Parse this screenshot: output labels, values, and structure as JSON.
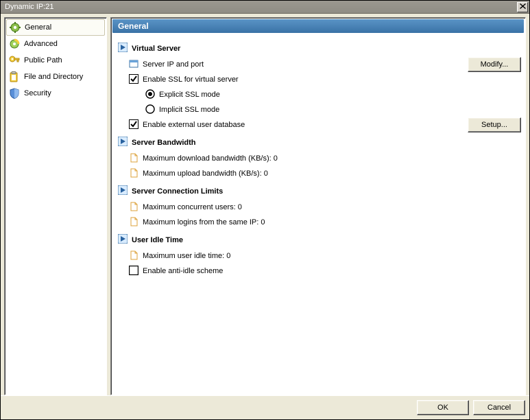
{
  "window": {
    "title": "Dynamic IP:21"
  },
  "sidebar": {
    "items": [
      {
        "label": "General"
      },
      {
        "label": "Advanced"
      },
      {
        "label": "Public Path"
      },
      {
        "label": "File and Directory"
      },
      {
        "label": "Security"
      }
    ]
  },
  "panel": {
    "title": "General"
  },
  "sections": {
    "virtual_server": {
      "title": "Virtual Server",
      "server_ip_port": "Server IP and port",
      "enable_ssl": {
        "label": "Enable SSL for virtual server",
        "checked": true
      },
      "explicit_ssl": {
        "label": "Explicit SSL mode",
        "selected": true
      },
      "implicit_ssl": {
        "label": "Implicit SSL mode",
        "selected": false
      },
      "enable_ext_db": {
        "label": "Enable external user database",
        "checked": true
      },
      "modify_btn": "Modify...",
      "setup_btn": "Setup..."
    },
    "bandwidth": {
      "title": "Server Bandwidth",
      "max_download": {
        "label": "Maximum download bandwidth (KB/s)",
        "value": 0
      },
      "max_upload": {
        "label": "Maximum upload bandwidth (KB/s)",
        "value": 0
      }
    },
    "conn_limits": {
      "title": "Server Connection Limits",
      "max_users": {
        "label": "Maximum concurrent users",
        "value": 0
      },
      "max_logins_same_ip": {
        "label": "Maximum logins from the same IP",
        "value": 0
      }
    },
    "idle": {
      "title": "User Idle Time",
      "max_idle": {
        "label": "Maximum user idle time",
        "value": 0
      },
      "anti_idle": {
        "label": "Enable anti-idle scheme",
        "checked": false
      }
    }
  },
  "footer": {
    "ok": "OK",
    "cancel": "Cancel"
  }
}
